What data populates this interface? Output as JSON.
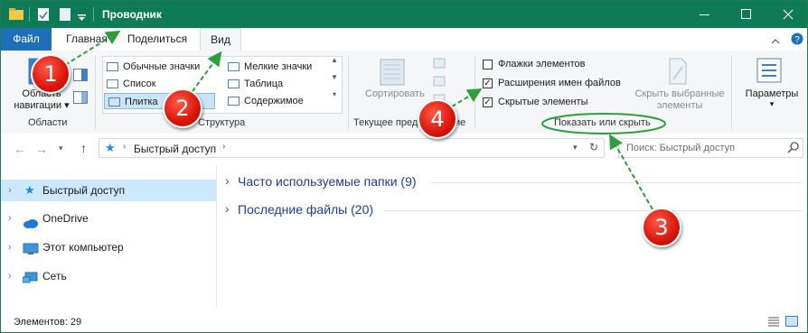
{
  "window": {
    "title": "Проводник",
    "controls": [
      "minimize",
      "maximize",
      "close"
    ]
  },
  "tabs": [
    {
      "label": "Файл",
      "active": false
    },
    {
      "label": "Главная",
      "active": false
    },
    {
      "label": "Поделиться",
      "active": false
    },
    {
      "label": "Вид",
      "active": true
    }
  ],
  "ribbon": {
    "areas_group": {
      "nav_pane_label_line1": "Область",
      "nav_pane_label_line2": "навигации",
      "group_label": "Области"
    },
    "layout_group": {
      "items": [
        {
          "label": "Обычные значки",
          "selected": false
        },
        {
          "label": "Мелкие значки",
          "selected": false
        },
        {
          "label": "Список",
          "selected": false
        },
        {
          "label": "Таблица",
          "selected": false
        },
        {
          "label": "Плитка",
          "selected": true
        },
        {
          "label": "Содержимое",
          "selected": false
        }
      ],
      "group_label": "Структура"
    },
    "current_view_group": {
      "sort_label": "Сортировать",
      "group_label": "Текущее представление"
    },
    "show_hide_group": {
      "checkboxes": [
        {
          "label": "Флажки элементов",
          "checked": false
        },
        {
          "label": "Расширения имен файлов",
          "checked": true
        },
        {
          "label": "Скрытые элементы",
          "checked": true
        }
      ],
      "hide_selected_line1": "Скрыть выбранные",
      "hide_selected_line2": "элементы",
      "group_label": "Показать или скрыть"
    },
    "options_label": "Параметры"
  },
  "address_bar": {
    "path": "Быстрый доступ",
    "search_placeholder": "Поиск: Быстрый доступ"
  },
  "nav_pane": {
    "items": [
      {
        "label": "Быстрый доступ",
        "icon": "star-icon",
        "selected": true
      },
      {
        "label": "OneDrive",
        "icon": "cloud-icon",
        "selected": false
      },
      {
        "label": "Этот компьютер",
        "icon": "computer-icon",
        "selected": false
      },
      {
        "label": "Сеть",
        "icon": "network-icon",
        "selected": false
      }
    ]
  },
  "content": {
    "sections": [
      {
        "label": "Часто используемые папки (9)"
      },
      {
        "label": "Последние файлы (20)"
      }
    ]
  },
  "status_bar": {
    "items_count": "Элементов: 29"
  },
  "annotations": {
    "markers": [
      "1",
      "2",
      "3",
      "4"
    ]
  },
  "colors": {
    "title_bar": "#0f7a56",
    "file_tab": "#1e6fb8",
    "selection": "#cce8ff",
    "marker_red": "#d8160a",
    "arrow_green": "#2e9e3e"
  }
}
